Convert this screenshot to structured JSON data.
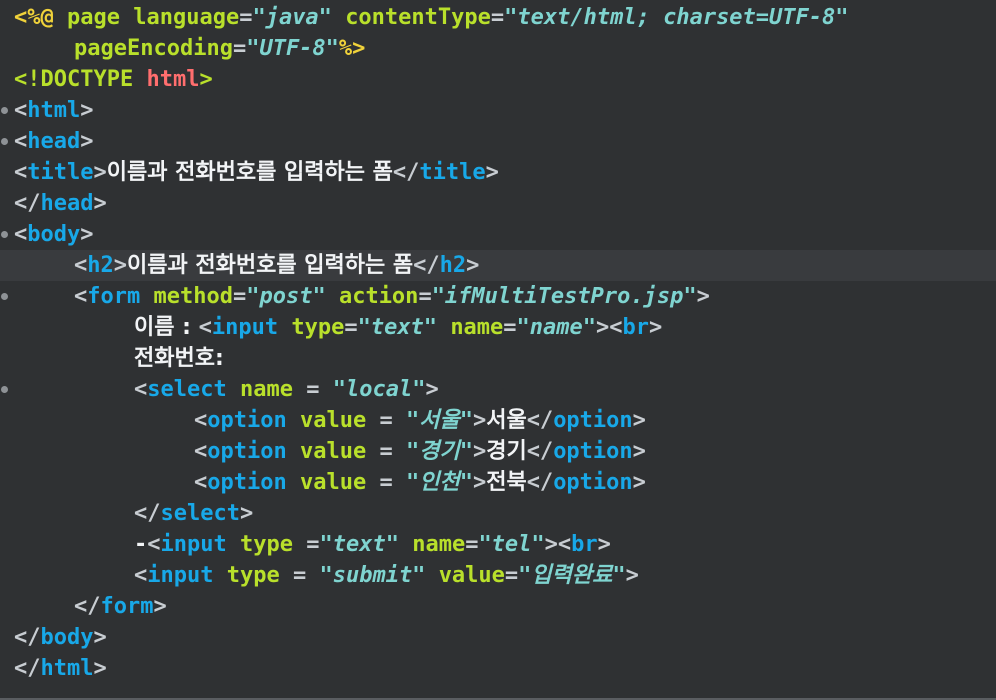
{
  "editor": {
    "language": "jsp",
    "current_line": 9,
    "colors": {
      "background": "#2f3133",
      "current_line": "#393b3e",
      "tag": "#18a8e8",
      "attribute": "#b9e02b",
      "string": "#7fd4d0",
      "text": "#f2f4f6",
      "jsp_delimiter": "#f0d23a",
      "doctype_name": "#ff6e6e"
    },
    "lines": [
      {
        "fold": false,
        "indent": 0,
        "tokens": [
          {
            "t": "jsp",
            "v": "<%@"
          },
          {
            "t": "plain",
            "v": " "
          },
          {
            "t": "attr",
            "v": "page"
          },
          {
            "t": "plain",
            "v": " "
          },
          {
            "t": "attr",
            "v": "language"
          },
          {
            "t": "punct",
            "v": "="
          },
          {
            "t": "str",
            "v": "\"java\""
          },
          {
            "t": "plain",
            "v": " "
          },
          {
            "t": "attr",
            "v": "contentType"
          },
          {
            "t": "punct",
            "v": "="
          },
          {
            "t": "str",
            "v": "\"text/html; charset=UTF-8\""
          }
        ]
      },
      {
        "fold": false,
        "indent": 4,
        "tokens": [
          {
            "t": "attr",
            "v": "pageEncoding"
          },
          {
            "t": "punct",
            "v": "="
          },
          {
            "t": "str",
            "v": "\"UTF-8\""
          },
          {
            "t": "jsp",
            "v": "%>"
          }
        ]
      },
      {
        "fold": false,
        "indent": 0,
        "tokens": [
          {
            "t": "doctype",
            "v": "<!DOCTYPE"
          },
          {
            "t": "plain",
            "v": " "
          },
          {
            "t": "doctypename",
            "v": "html"
          },
          {
            "t": "doctype",
            "v": ">"
          }
        ]
      },
      {
        "fold": true,
        "indent": 0,
        "tokens": [
          {
            "t": "punct",
            "v": "<"
          },
          {
            "t": "tag",
            "v": "html"
          },
          {
            "t": "punct",
            "v": ">"
          }
        ]
      },
      {
        "fold": true,
        "indent": 0,
        "tokens": [
          {
            "t": "punct",
            "v": "<"
          },
          {
            "t": "tag",
            "v": "head"
          },
          {
            "t": "punct",
            "v": ">"
          }
        ]
      },
      {
        "fold": false,
        "indent": 0,
        "tokens": [
          {
            "t": "punct",
            "v": "<"
          },
          {
            "t": "tag",
            "v": "title"
          },
          {
            "t": "punct",
            "v": ">"
          },
          {
            "t": "text",
            "v": "이름과 전화번호를 입력하는 폼"
          },
          {
            "t": "punct",
            "v": "</"
          },
          {
            "t": "tag",
            "v": "title"
          },
          {
            "t": "punct",
            "v": ">"
          }
        ]
      },
      {
        "fold": false,
        "indent": 0,
        "tokens": [
          {
            "t": "punct",
            "v": "</"
          },
          {
            "t": "tag",
            "v": "head"
          },
          {
            "t": "punct",
            "v": ">"
          }
        ]
      },
      {
        "fold": true,
        "indent": 0,
        "tokens": [
          {
            "t": "punct",
            "v": "<"
          },
          {
            "t": "tag",
            "v": "body"
          },
          {
            "t": "punct",
            "v": ">"
          }
        ]
      },
      {
        "fold": false,
        "indent": 4,
        "tokens": [
          {
            "t": "punct",
            "v": "<"
          },
          {
            "t": "tag",
            "v": "h2"
          },
          {
            "t": "punct",
            "v": ">"
          },
          {
            "t": "text",
            "v": "이름과 전화번호를 입력하는 폼"
          },
          {
            "t": "punct",
            "v": "</"
          },
          {
            "t": "tag",
            "v": "h2"
          },
          {
            "t": "punct",
            "v": ">"
          }
        ]
      },
      {
        "fold": true,
        "indent": 4,
        "tokens": [
          {
            "t": "punct",
            "v": "<"
          },
          {
            "t": "tag",
            "v": "form"
          },
          {
            "t": "plain",
            "v": " "
          },
          {
            "t": "attr",
            "v": "method"
          },
          {
            "t": "punct",
            "v": "="
          },
          {
            "t": "str",
            "v": "\"post\""
          },
          {
            "t": "plain",
            "v": " "
          },
          {
            "t": "attr",
            "v": "action"
          },
          {
            "t": "punct",
            "v": "="
          },
          {
            "t": "str",
            "v": "\"ifMultiTestPro.jsp\""
          },
          {
            "t": "punct",
            "v": ">"
          }
        ]
      },
      {
        "fold": false,
        "indent": 8,
        "tokens": [
          {
            "t": "text",
            "v": "이름 : "
          },
          {
            "t": "punct",
            "v": "<"
          },
          {
            "t": "tag",
            "v": "input"
          },
          {
            "t": "plain",
            "v": " "
          },
          {
            "t": "attr",
            "v": "type"
          },
          {
            "t": "punct",
            "v": "="
          },
          {
            "t": "str",
            "v": "\"text\""
          },
          {
            "t": "plain",
            "v": " "
          },
          {
            "t": "attr",
            "v": "name"
          },
          {
            "t": "punct",
            "v": "="
          },
          {
            "t": "str",
            "v": "\"name\""
          },
          {
            "t": "punct",
            "v": "><"
          },
          {
            "t": "tag",
            "v": "br"
          },
          {
            "t": "punct",
            "v": ">"
          }
        ]
      },
      {
        "fold": false,
        "indent": 8,
        "tokens": [
          {
            "t": "text",
            "v": "전화번호:"
          }
        ]
      },
      {
        "fold": true,
        "indent": 8,
        "tokens": [
          {
            "t": "punct",
            "v": "<"
          },
          {
            "t": "tag",
            "v": "select"
          },
          {
            "t": "plain",
            "v": " "
          },
          {
            "t": "attr",
            "v": "name"
          },
          {
            "t": "punct",
            "v": " = "
          },
          {
            "t": "str",
            "v": "\"local\""
          },
          {
            "t": "punct",
            "v": ">"
          }
        ]
      },
      {
        "fold": false,
        "indent": 12,
        "tokens": [
          {
            "t": "punct",
            "v": "<"
          },
          {
            "t": "tag",
            "v": "option"
          },
          {
            "t": "plain",
            "v": " "
          },
          {
            "t": "attr",
            "v": "value"
          },
          {
            "t": "punct",
            "v": " = "
          },
          {
            "t": "str",
            "v": "\"서울\""
          },
          {
            "t": "punct",
            "v": ">"
          },
          {
            "t": "text",
            "v": "서울"
          },
          {
            "t": "punct",
            "v": "</"
          },
          {
            "t": "tag",
            "v": "option"
          },
          {
            "t": "punct",
            "v": ">"
          }
        ]
      },
      {
        "fold": false,
        "indent": 12,
        "tokens": [
          {
            "t": "punct",
            "v": "<"
          },
          {
            "t": "tag",
            "v": "option"
          },
          {
            "t": "plain",
            "v": " "
          },
          {
            "t": "attr",
            "v": "value"
          },
          {
            "t": "punct",
            "v": " = "
          },
          {
            "t": "str",
            "v": "\"경기\""
          },
          {
            "t": "punct",
            "v": ">"
          },
          {
            "t": "text",
            "v": "경기"
          },
          {
            "t": "punct",
            "v": "</"
          },
          {
            "t": "tag",
            "v": "option"
          },
          {
            "t": "punct",
            "v": ">"
          }
        ]
      },
      {
        "fold": false,
        "indent": 12,
        "tokens": [
          {
            "t": "punct",
            "v": "<"
          },
          {
            "t": "tag",
            "v": "option"
          },
          {
            "t": "plain",
            "v": " "
          },
          {
            "t": "attr",
            "v": "value"
          },
          {
            "t": "punct",
            "v": " = "
          },
          {
            "t": "str",
            "v": "\"인천\""
          },
          {
            "t": "punct",
            "v": ">"
          },
          {
            "t": "text",
            "v": "전북"
          },
          {
            "t": "punct",
            "v": "</"
          },
          {
            "t": "tag",
            "v": "option"
          },
          {
            "t": "punct",
            "v": ">"
          }
        ]
      },
      {
        "fold": false,
        "indent": 8,
        "tokens": [
          {
            "t": "punct",
            "v": "</"
          },
          {
            "t": "tag",
            "v": "select"
          },
          {
            "t": "punct",
            "v": ">"
          }
        ]
      },
      {
        "fold": false,
        "indent": 8,
        "tokens": [
          {
            "t": "dash",
            "v": "-"
          },
          {
            "t": "punct",
            "v": "<"
          },
          {
            "t": "tag",
            "v": "input"
          },
          {
            "t": "plain",
            "v": " "
          },
          {
            "t": "attr",
            "v": "type"
          },
          {
            "t": "punct",
            "v": " ="
          },
          {
            "t": "str",
            "v": "\"text\""
          },
          {
            "t": "plain",
            "v": " "
          },
          {
            "t": "attr",
            "v": "name"
          },
          {
            "t": "punct",
            "v": "="
          },
          {
            "t": "str",
            "v": "\"tel\""
          },
          {
            "t": "punct",
            "v": "><"
          },
          {
            "t": "tag",
            "v": "br"
          },
          {
            "t": "punct",
            "v": ">"
          }
        ]
      },
      {
        "fold": false,
        "indent": 8,
        "tokens": [
          {
            "t": "punct",
            "v": "<"
          },
          {
            "t": "tag",
            "v": "input"
          },
          {
            "t": "plain",
            "v": " "
          },
          {
            "t": "attr",
            "v": "type"
          },
          {
            "t": "punct",
            "v": " = "
          },
          {
            "t": "str",
            "v": "\"submit\""
          },
          {
            "t": "plain",
            "v": " "
          },
          {
            "t": "attr",
            "v": "value"
          },
          {
            "t": "punct",
            "v": "="
          },
          {
            "t": "str",
            "v": "\"입력완료\""
          },
          {
            "t": "punct",
            "v": ">"
          }
        ]
      },
      {
        "fold": false,
        "indent": 4,
        "tokens": [
          {
            "t": "punct",
            "v": "</"
          },
          {
            "t": "tag",
            "v": "form"
          },
          {
            "t": "punct",
            "v": ">"
          }
        ]
      },
      {
        "fold": false,
        "indent": 0,
        "tokens": [
          {
            "t": "punct",
            "v": "</"
          },
          {
            "t": "tag",
            "v": "body"
          },
          {
            "t": "punct",
            "v": ">"
          }
        ]
      },
      {
        "fold": false,
        "indent": 0,
        "tokens": [
          {
            "t": "punct",
            "v": "</"
          },
          {
            "t": "tag",
            "v": "html"
          },
          {
            "t": "punct",
            "v": ">"
          }
        ]
      }
    ]
  }
}
